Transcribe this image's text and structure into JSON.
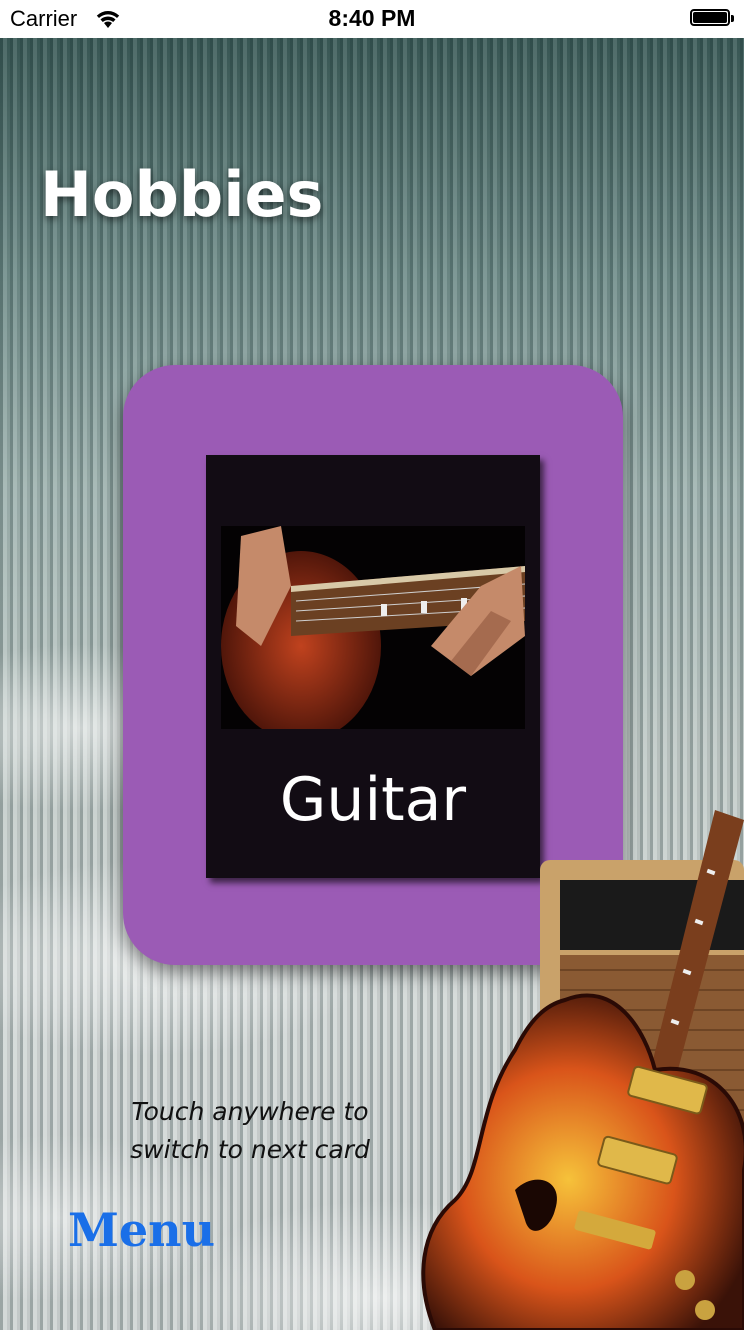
{
  "status_bar": {
    "carrier": "Carrier",
    "time": "8:40 PM"
  },
  "page": {
    "title": "Hobbies"
  },
  "card": {
    "label": "Guitar",
    "color": "#9b5bb5",
    "image": "guitar-playing-photo"
  },
  "hint": {
    "line1": "Touch anywhere to",
    "line2": "switch to next card"
  },
  "menu": {
    "label": "Menu",
    "color": "#1a6fe8"
  }
}
